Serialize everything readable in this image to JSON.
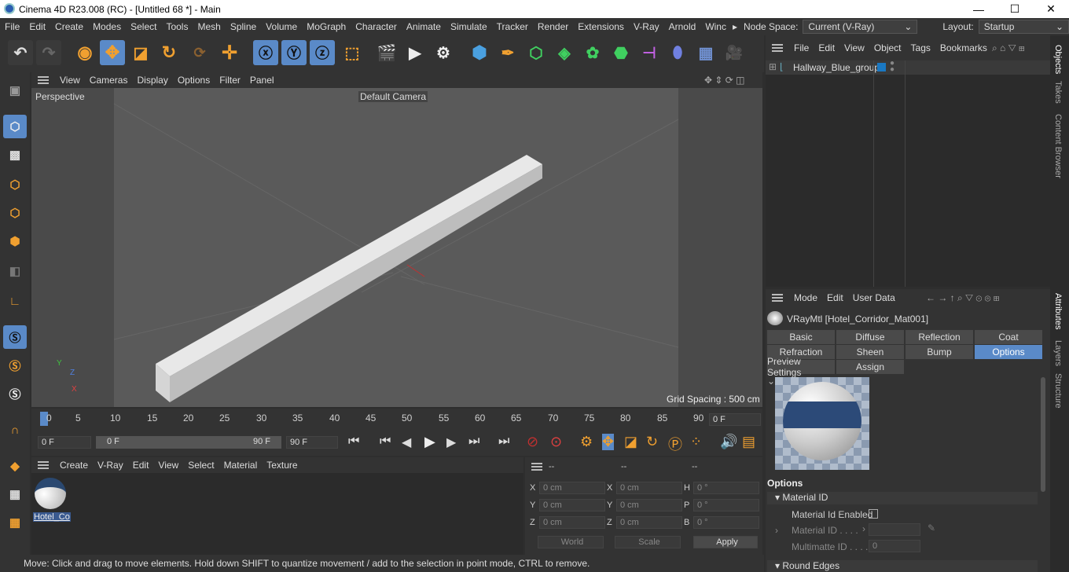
{
  "window": {
    "title": "Cinema 4D R23.008 (RC) - [Untitled 68 *] - Main",
    "min": "—",
    "max": "☐",
    "close": "✕"
  },
  "menu": [
    "File",
    "Edit",
    "Create",
    "Modes",
    "Select",
    "Tools",
    "Mesh",
    "Spline",
    "Volume",
    "MoGraph",
    "Character",
    "Animate",
    "Simulate",
    "Tracker",
    "Render",
    "Extensions",
    "V-Ray",
    "Arnold",
    "Winc"
  ],
  "nodespace": {
    "label": "Node Space:",
    "value": "Current (V-Ray)"
  },
  "layout": {
    "label": "Layout:",
    "value": "Startup"
  },
  "viewport": {
    "menu": [
      "View",
      "Cameras",
      "Display",
      "Options",
      "Filter",
      "Panel"
    ],
    "label": "Perspective",
    "camera": "Default Camera",
    "grid": "Grid Spacing : 500 cm",
    "axes": {
      "y": "Y",
      "z": "Z",
      "x": "X"
    }
  },
  "timeline": {
    "ticks": [
      "0",
      "5",
      "10",
      "15",
      "20",
      "25",
      "30",
      "35",
      "40",
      "45",
      "50",
      "55",
      "60",
      "65",
      "70",
      "75",
      "80",
      "85",
      "90"
    ],
    "current": "0 F"
  },
  "transport": {
    "start": "0 F",
    "range_start": "0 F",
    "range_end": "90 F",
    "end": "90 F"
  },
  "matmgr": {
    "menu": [
      "Create",
      "V-Ray",
      "Edit",
      "View",
      "Select",
      "Material",
      "Texture"
    ],
    "material": "Hotel_Co"
  },
  "coords": {
    "col1": "--",
    "col2": "--",
    "col3": "--",
    "rows": [
      {
        "a": "X",
        "av": "0 cm",
        "b": "X",
        "bv": "0 cm",
        "c": "H",
        "cv": "0 °"
      },
      {
        "a": "Y",
        "av": "0 cm",
        "b": "Y",
        "bv": "0 cm",
        "c": "P",
        "cv": "0 °"
      },
      {
        "a": "Z",
        "av": "0 cm",
        "b": "Z",
        "bv": "0 cm",
        "c": "B",
        "cv": "0 °"
      }
    ],
    "world": "World",
    "scale": "Scale",
    "apply": "Apply"
  },
  "objects": {
    "menu": [
      "File",
      "Edit",
      "View",
      "Object",
      "Tags",
      "Bookmarks"
    ],
    "item": "Hallway_Blue_group"
  },
  "attributes": {
    "menu": [
      "Mode",
      "Edit",
      "User Data"
    ],
    "header": "VRayMtl [Hotel_Corridor_Mat001]",
    "tabs1": [
      "Basic",
      "Diffuse",
      "Reflection",
      "Coat"
    ],
    "tabs2": [
      "Refraction",
      "Sheen",
      "Bump",
      "Options"
    ],
    "tabs3": [
      "Preview Settings",
      "Assign"
    ],
    "section": "Options",
    "group": "Material ID",
    "mid_enabled": "Material Id Enabled",
    "mid": "Material ID . . . .",
    "multimatte": "Multimatte ID . . . .",
    "multimatte_val": "0",
    "round": "Round Edges"
  },
  "righttabs": [
    "Objects",
    "Takes",
    "Content Browser",
    "Attributes",
    "Layers",
    "Structure"
  ],
  "status": "Move: Click and drag to move elements. Hold down SHIFT to quantize movement / add to the selection in point mode, CTRL to remove."
}
